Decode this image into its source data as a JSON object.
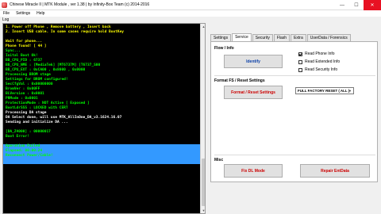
{
  "window": {
    "title": "Chinese Miracle II | MTK Module , ver 1.38 | by Infinity-Box Team (c) 2014-2016",
    "controls": {
      "minimize": "—",
      "maximize": "☐",
      "close": "✕"
    }
  },
  "menu": [
    "File",
    "Settings",
    "Help"
  ],
  "log_label": "Log",
  "log_lines": [
    {
      "text": "1. Power off Phone , Remove battery , Insert back",
      "color": "yellow"
    },
    {
      "text": "2. Insert USB cable. In some cases require hold BootKey",
      "color": "yellow"
    },
    {
      "text": "",
      "color": "yellow"
    },
    {
      "text": "Wait for phone...",
      "color": "yellow"
    },
    {
      "text": "Phone found! [ 44 ]",
      "color": "yellow"
    },
    {
      "text": "Sync...",
      "color": "green"
    },
    {
      "text": "Inital Boot Ok!",
      "color": "green"
    },
    {
      "text": "BB_CPU_PID : 6737",
      "color": "green"
    },
    {
      "text": "BB_CPU_NME : [MediaTek] [MT6737M] [T6737_S00",
      "color": "green"
    },
    {
      "text": "BB_CPU_EXT : 0xCA00 , 0x8000 , 0x0000",
      "color": "green"
    },
    {
      "text": "Processing BROM stage",
      "color": "green"
    },
    {
      "text": "Settings for BROM configured!",
      "color": "green"
    },
    {
      "text": "SecCfgVal : 0x00000000",
      "color": "green"
    },
    {
      "text": "BromVer : 0x00FF",
      "color": "green"
    },
    {
      "text": "BLVersion : 0x0001",
      "color": "green"
    },
    {
      "text": "PRMode : 0x0001",
      "color": "green"
    },
    {
      "text": "ProtectionMode : NOT Active [ Exposed ]",
      "color": "green"
    },
    {
      "text": "BootLdrSSS : LOCKED with CERT",
      "color": "green"
    },
    {
      "text": "Processing DA stage",
      "color": "white"
    },
    {
      "text": "DA Select done, will use MTK_AllInOne_DA_v3.1624.16.07",
      "color": "white"
    },
    {
      "text": "Sending and initialize DA ...",
      "color": "white"
    },
    {
      "text": "",
      "color": "green"
    },
    {
      "text": "[DA_Z4000] : 00000017",
      "color": "green"
    },
    {
      "text": "Boot Error!",
      "color": "green"
    },
    {
      "text": "",
      "color": "green"
    },
    {
      "text": "Operation Failed",
      "color": "green"
    },
    {
      "text": "Elapsed: 00:00:24",
      "color": "green"
    },
    {
      "text": "Reconnect Power/Cable!",
      "color": "green"
    }
  ],
  "tabs": [
    {
      "label": "Settings",
      "active": false
    },
    {
      "label": "Service",
      "active": true
    },
    {
      "label": "Security",
      "active": false
    },
    {
      "label": "Flash",
      "active": false
    },
    {
      "label": "Extra",
      "active": false
    },
    {
      "label": "UserData / Forensics",
      "active": false
    }
  ],
  "panel": {
    "flow_info_label": "Flow / Info",
    "identify_button": "Identify",
    "checkboxes": [
      {
        "label": "Read Phone Info",
        "checked": true
      },
      {
        "label": "Read Extended Info",
        "checked": false
      },
      {
        "label": "Read Security Info",
        "checked": false
      }
    ],
    "format_label": "Format FS / Reset Settings",
    "format_button": "Format / Reset Settings",
    "format_select_value": "FULL FACTORY RESET ( ALL )",
    "misc_label": "Misc",
    "fix_dl_button": "Fix DL Mode",
    "repair_button": "Repair EntData"
  }
}
